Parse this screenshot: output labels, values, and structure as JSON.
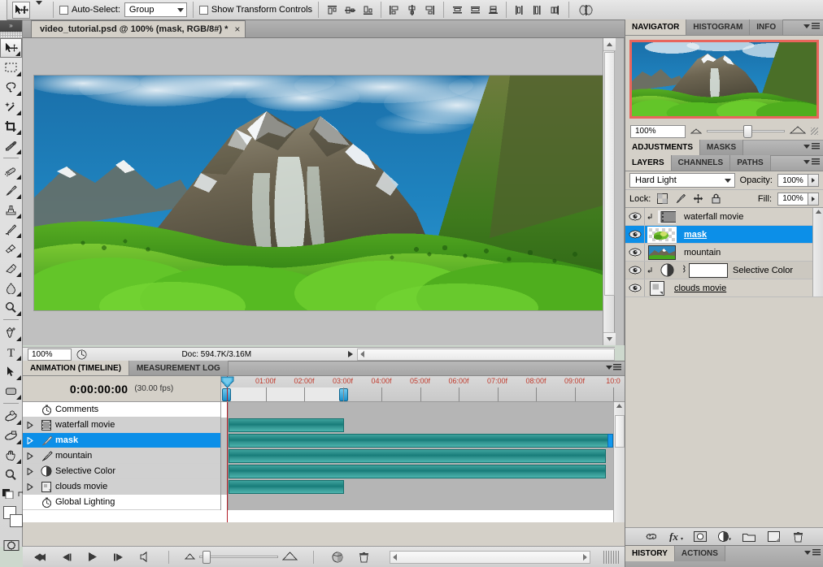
{
  "options_bar": {
    "tool_preset_icon": "move-tool-icon",
    "auto_select_label": "Auto-Select:",
    "auto_select_value": "Group",
    "show_transform_label": "Show Transform Controls",
    "align_icons": [
      "align-top-edges-icon",
      "align-vertical-centers-icon",
      "align-bottom-edges-icon",
      "align-left-edges-icon",
      "align-horizontal-centers-icon",
      "align-right-edges-icon"
    ],
    "distribute_icons": [
      "distribute-top-edges-icon",
      "distribute-vertical-centers-icon",
      "distribute-bottom-edges-icon",
      "distribute-left-edges-icon",
      "distribute-horizontal-centers-icon",
      "distribute-right-edges-icon"
    ],
    "auto_align_icon": "auto-align-layers-icon"
  },
  "toolbox": {
    "tools": [
      {
        "name": "move-tool",
        "selected": true
      },
      {
        "name": "rectangular-marquee-tool",
        "selected": false
      },
      {
        "name": "lasso-tool",
        "selected": false
      },
      {
        "name": "magic-wand-tool",
        "selected": false
      },
      {
        "name": "crop-tool",
        "selected": false
      },
      {
        "name": "eyedropper-tool",
        "selected": false
      },
      {
        "name": "healing-brush-tool",
        "selected": false
      },
      {
        "name": "brush-tool",
        "selected": false
      },
      {
        "name": "clone-stamp-tool",
        "selected": false
      },
      {
        "name": "history-brush-tool",
        "selected": false
      },
      {
        "name": "eraser-tool",
        "selected": false
      },
      {
        "name": "gradient-tool",
        "selected": false
      },
      {
        "name": "blur-tool",
        "selected": false
      },
      {
        "name": "dodge-tool",
        "selected": false
      },
      {
        "name": "pen-tool",
        "selected": false
      },
      {
        "name": "horizontal-type-tool",
        "selected": false
      },
      {
        "name": "path-selection-tool",
        "selected": false
      },
      {
        "name": "rounded-rectangle-tool",
        "selected": false
      },
      {
        "name": "3d-rotate-tool",
        "selected": false
      },
      {
        "name": "3d-orbit-tool",
        "selected": false
      },
      {
        "name": "hand-tool",
        "selected": false
      },
      {
        "name": "zoom-tool",
        "selected": false
      }
    ],
    "foreground_color": "#ffffff",
    "background_color": "#ffffff",
    "quick_mask_label": "quick-mask-mode"
  },
  "document": {
    "tab_title": "video_tutorial.psd @ 100% (mask, RGB/8#) *",
    "close_glyph": "×",
    "zoom_level": "100%",
    "doc_info": "Doc: 594.7K/3.16M"
  },
  "animation_panel": {
    "tabs": [
      {
        "label": "ANIMATION (TIMELINE)",
        "active": true
      },
      {
        "label": "MEASUREMENT LOG",
        "active": false
      }
    ],
    "timecode": "0:00:00:00",
    "fps": "(30.00 fps)",
    "ruler_labels": [
      "01:00f",
      "02:00f",
      "03:00f",
      "04:00f",
      "05:00f",
      "06:00f",
      "07:00f",
      "08:00f",
      "09:00f",
      "10:0"
    ],
    "tracks": [
      {
        "name": "Comments",
        "icon": "stopwatch-icon",
        "has_disclosure": false,
        "bar": false,
        "row_style": "white",
        "selected": false
      },
      {
        "name": "waterfall movie",
        "icon": "video-layer-icon",
        "has_disclosure": true,
        "bar": true,
        "bar_width_pct": 30,
        "row_style": "grey",
        "selected": false
      },
      {
        "name": "mask",
        "icon": "brush-icon",
        "has_disclosure": true,
        "bar": true,
        "bar_width_pct": 100,
        "row_style": "grey",
        "selected": true
      },
      {
        "name": "mountain",
        "icon": "brush-icon",
        "has_disclosure": true,
        "bar": true,
        "bar_width_pct": 98,
        "row_style": "grey",
        "selected": false
      },
      {
        "name": "Selective Color",
        "icon": "adjustment-circle-icon",
        "has_disclosure": true,
        "bar": true,
        "bar_width_pct": 98,
        "row_style": "grey",
        "selected": false
      },
      {
        "name": "clouds movie",
        "icon": "smart-object-icon",
        "has_disclosure": true,
        "bar": true,
        "bar_width_pct": 30,
        "row_style": "grey",
        "selected": false
      },
      {
        "name": "Global Lighting",
        "icon": "stopwatch-icon",
        "has_disclosure": false,
        "bar": false,
        "row_style": "white",
        "selected": false
      }
    ],
    "footer_buttons": [
      "rewind-to-start-icon",
      "step-back-frame-icon",
      "play-icon",
      "step-forward-frame-icon",
      "audio-icon",
      "onion-skin-icon",
      "delete-keyframes-icon"
    ],
    "zoom_slider_value": 6
  },
  "navigator": {
    "tabs": [
      {
        "label": "NAVIGATOR",
        "active": true
      },
      {
        "label": "HISTOGRAM",
        "active": false
      },
      {
        "label": "INFO",
        "active": false
      }
    ],
    "zoom_value": "100%",
    "zoom_out_icon": "small-mountain-icon",
    "zoom_in_icon": "large-mountain-icon",
    "view_box_color": "#e8655c"
  },
  "adjustments": {
    "tabs": [
      {
        "label": "ADJUSTMENTS",
        "active": true
      },
      {
        "label": "MASKS",
        "active": false
      }
    ]
  },
  "layers_panel": {
    "tabs": [
      {
        "label": "LAYERS",
        "active": true
      },
      {
        "label": "CHANNELS",
        "active": false
      },
      {
        "label": "PATHS",
        "active": false
      }
    ],
    "blend_mode": "Hard Light",
    "opacity_label": "Opacity:",
    "opacity_value": "100%",
    "lock_label": "Lock:",
    "lock_icons": [
      "lock-transparent-pixels-icon",
      "lock-image-pixels-icon",
      "lock-position-icon",
      "lock-all-icon"
    ],
    "fill_label": "Fill:",
    "fill_value": "100%",
    "layers": [
      {
        "name": "waterfall movie",
        "visible": true,
        "selected": false,
        "clipped": true,
        "thumb": "video-layer-icon",
        "kind": "video"
      },
      {
        "name": "mask",
        "visible": true,
        "selected": true,
        "clipped": false,
        "thumb": "mask-thumb",
        "kind": "mask"
      },
      {
        "name": "mountain",
        "visible": true,
        "selected": false,
        "clipped": false,
        "thumb": "mountain-thumb",
        "kind": "image"
      },
      {
        "name": "Selective Color",
        "visible": true,
        "selected": false,
        "clipped": true,
        "thumb": "adjustment-circle-icon",
        "kind": "adjustment"
      },
      {
        "name": "clouds movie",
        "visible": true,
        "selected": false,
        "clipped": false,
        "thumb": "smart-object-icon",
        "kind": "smart"
      }
    ],
    "footer_buttons": [
      "link-layers-icon",
      "layer-style-fx-icon",
      "add-layer-mask-icon",
      "new-adjustment-layer-icon",
      "new-group-icon",
      "new-layer-icon",
      "delete-layer-icon"
    ]
  },
  "history_panel": {
    "tabs": [
      {
        "label": "HISTORY",
        "active": true
      },
      {
        "label": "ACTIONS",
        "active": false
      }
    ]
  }
}
